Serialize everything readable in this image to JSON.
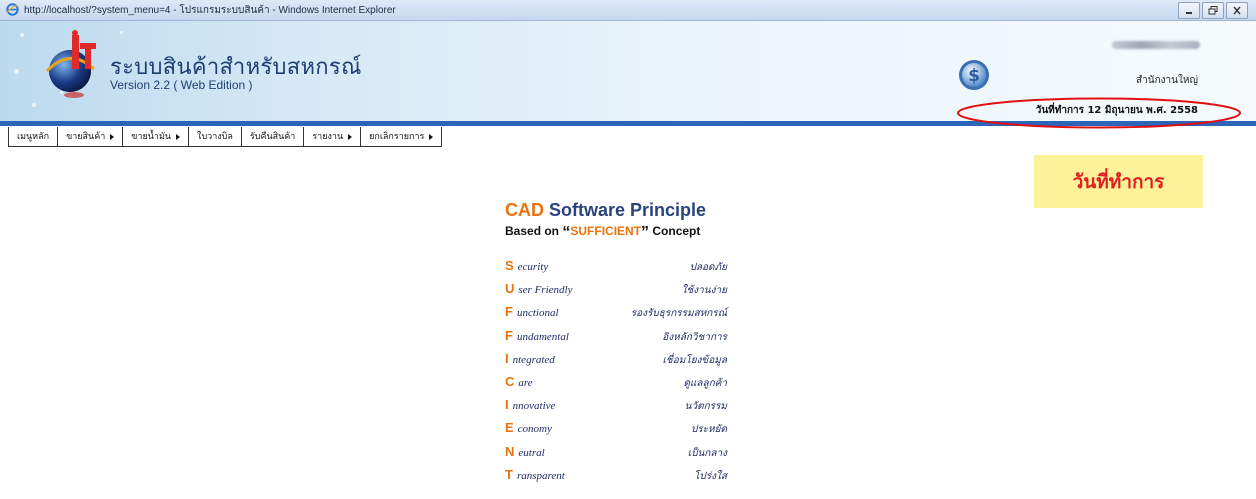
{
  "window": {
    "title": "http://localhost/?system_menu=4 - โปรแกรมระบบสินค้า - Windows Internet Explorer",
    "buttons": [
      "minimize-icon",
      "restore-icon",
      "close-icon"
    ]
  },
  "header": {
    "app_title": "ระบบสินค้าสำหรับสหกรณ์",
    "app_version": "Version 2.2 ( Web Edition )",
    "branch": "สำนักงานใหญ่",
    "work_date": "วันที่ทำการ 12 มิถุนายน พ.ศ. 2558"
  },
  "menu": [
    {
      "label": "เมนูหลัก",
      "has_submenu": false
    },
    {
      "label": "ขายสินค้า",
      "has_submenu": true
    },
    {
      "label": "ขายน้ำมัน",
      "has_submenu": true
    },
    {
      "label": "ใบวางบิล",
      "has_submenu": false
    },
    {
      "label": "รับคืนสินค้า",
      "has_submenu": false
    },
    {
      "label": "รายงาน",
      "has_submenu": true
    },
    {
      "label": "ยกเลิกรายการ",
      "has_submenu": true
    }
  ],
  "callout": {
    "text": "วันที่ทำการ",
    "background": "#fdf29a",
    "color": "#e02020"
  },
  "principle": {
    "title_cad": "CAD",
    "title_rest": " Software Principle",
    "subtitle_before": "Based on ",
    "subtitle_open_quote": "“",
    "subtitle_highlight": "SUFFICIENT",
    "subtitle_close_quote": "”",
    "subtitle_after": " Concept",
    "items": [
      {
        "letter": "S",
        "rest": "ecurity",
        "thai": "ปลอดภัย"
      },
      {
        "letter": "U",
        "rest": "ser Friendly",
        "thai": "ใช้งานง่าย"
      },
      {
        "letter": "F",
        "rest": "unctional",
        "thai": "รองรับธุรกรรมสหกรณ์"
      },
      {
        "letter": "F",
        "rest": "undamental",
        "thai": "อิงหลักวิชาการ"
      },
      {
        "letter": "I",
        "rest": "ntegrated",
        "thai": "เชื่อมโยงข้อมูล"
      },
      {
        "letter": "C",
        "rest": "are",
        "thai": "ดูแลลูกค้า"
      },
      {
        "letter": "I",
        "rest": "nnovative",
        "thai": "นวัตกรรม"
      },
      {
        "letter": "E",
        "rest": "conomy",
        "thai": "ประหยัด"
      },
      {
        "letter": "N",
        "rest": "eutral",
        "thai": "เป็นกลาง"
      },
      {
        "letter": "T",
        "rest": "ransparent",
        "thai": "โปร่งใส"
      }
    ]
  },
  "colors": {
    "accent_orange": "#e8720c",
    "navy": "#28437d",
    "header_line": "#2c64b8",
    "highlight_ellipse": "#e01010"
  }
}
